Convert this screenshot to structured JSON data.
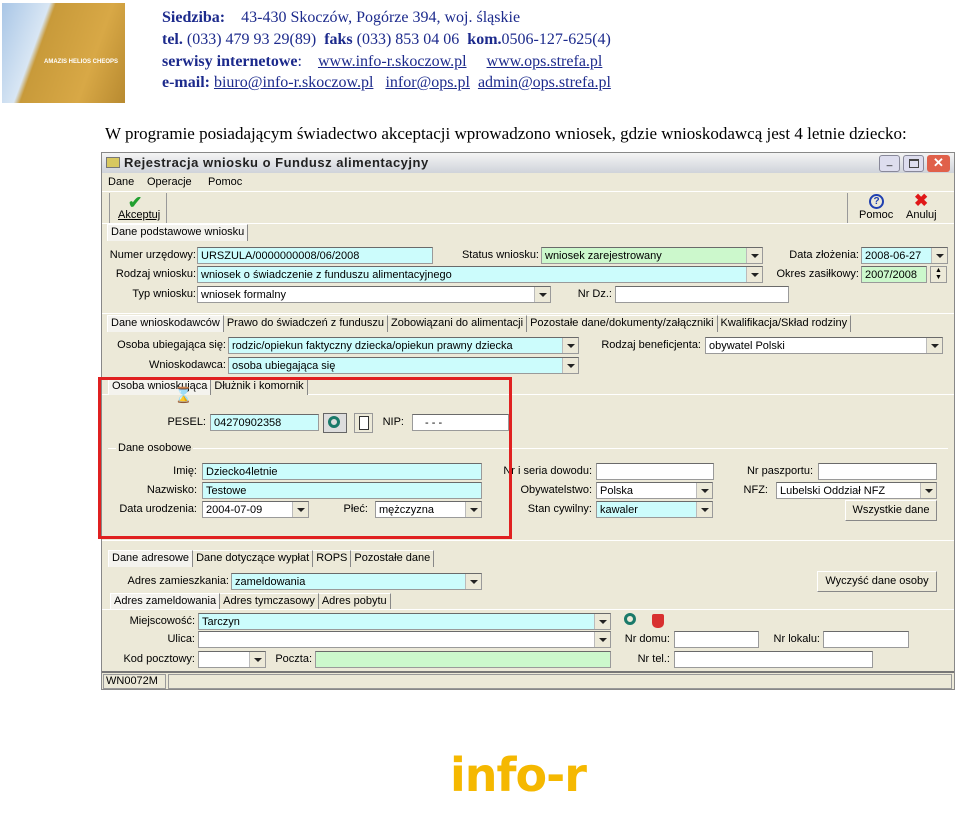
{
  "letterhead": {
    "logo_text": "AMAZIS HELIOS CHEOPS",
    "line1_label": "Siedziba:",
    "line1_text": "43-430 Skoczów,  Pogórze 394,  woj. śląskie",
    "tel_label": "tel.",
    "tel": "(033) 479 93 29(89)",
    "fax_label": "faks",
    "fax": "(033) 853 04 06",
    "kom_label": "kom.",
    "kom": "0506-127-625(4)",
    "web_label": "serwisy internetowe",
    "web_colon": ":",
    "web1": "www.info-r.skoczow.pl",
    "web2": "www.ops.strefa.pl",
    "email_label": "e-mail:",
    "email1": "biuro@info-r.skoczow.pl",
    "email2": "infor@ops.pl",
    "email3": "admin@ops.strefa.pl"
  },
  "heading": "W programie posiadającym świadectwo akceptacji wprowadzono wniosek, gdzie wnioskodawcą jest 4 letnie dziecko:",
  "window": {
    "title": "Rejestracja wniosku o Fundusz alimentacyjny",
    "menu": [
      "Dane",
      "Operacje",
      "Pomoc"
    ],
    "toolbar": {
      "accept": "Akceptuj",
      "help": "Pomoc",
      "cancel": "Anuluj"
    },
    "top_tab": "Dane podstawowe wniosku",
    "basic": {
      "numer_label": "Numer urzędowy:",
      "numer": "URSZULA/0000000008/06/2008",
      "status_label": "Status wniosku:",
      "status": "wniosek zarejestrowany",
      "data_label": "Data złożenia:",
      "data": "2008-06-27",
      "rodzaj_label": "Rodzaj wniosku:",
      "rodzaj": "wniosek o świadczenie z funduszu alimentacyjnego",
      "okres_label": "Okres zasiłkowy:",
      "okres": "2007/2008",
      "typ_label": "Typ wniosku:",
      "typ": "wniosek formalny",
      "nrdz_label": "Nr Dz.:",
      "nrdz": ""
    },
    "main_tabs": [
      "Dane wnioskodawców",
      "Prawo do świadczeń z funduszu",
      "Zobowiązani do alimentacji",
      "Pozostałe dane/dokumenty/załączniki",
      "Kwalifikacja/Skład rodziny"
    ],
    "applicant": {
      "osoba_label": "Osoba ubiegająca się:",
      "osoba": "rodzic/opiekun faktyczny dziecka/opiekun prawny dziecka",
      "benef_label": "Rodzaj beneficjenta:",
      "benef": "obywatel Polski",
      "wniosk_label": "Wnioskodawca:",
      "wniosk": "osoba ubiegająca się"
    },
    "person_tabs": [
      "Osoba wnioskująca",
      "Dłużnik i komornik"
    ],
    "person": {
      "pesel_label": "PESEL:",
      "pesel": "04270902358",
      "nip_label": "NIP:",
      "nip": "- - -",
      "group": "Dane osobowe",
      "imie_label": "Imię:",
      "imie": "Dziecko4letnie",
      "nazwisko_label": "Nazwisko:",
      "nazwisko": "Testowe",
      "dataur_label": "Data urodzenia:",
      "dataur": "2004-07-09",
      "plec_label": "Płeć:",
      "plec": "mężczyzna",
      "dowod_label": "Nr i seria dowodu:",
      "dowod": "",
      "obyw_label": "Obywatelstwo:",
      "obyw": "Polska",
      "stan_label": "Stan cywilny:",
      "stan": "kawaler",
      "paszport_label": "Nr paszportu:",
      "paszport": "",
      "nfz_label": "NFZ:",
      "nfz": "Lubelski Oddział NFZ",
      "all_data": "Wszystkie dane"
    },
    "addr_tabs": [
      "Dane adresowe",
      "Dane dotyczące wypłat",
      "ROPS",
      "Pozostałe dane"
    ],
    "addr": {
      "zam_label": "Adres zamieszkania:",
      "zam": "zameldowania",
      "clear": "Wyczyść dane osoby",
      "sub_tabs": [
        "Adres zameldowania",
        "Adres tymczasowy",
        "Adres pobytu"
      ],
      "miejsc_label": "Miejscowość:",
      "miejsc": "Tarczyn",
      "ulica_label": "Ulica:",
      "ulica": "",
      "nrdomu_label": "Nr domu:",
      "nrdomu": "",
      "nrlok_label": "Nr lokalu:",
      "nrlok": "",
      "kod_label": "Kod pocztowy:",
      "kod": "",
      "poczta_label": "Poczta:",
      "poczta": "",
      "tel_label": "Nr tel.:",
      "tel": ""
    },
    "status_bar": "WN0072M"
  },
  "footer_logo": "info-r",
  "colors": {
    "cyan_field": "#ccfcfc",
    "green_field": "#ccf8cc",
    "highlight": "#e02020",
    "logo": "#f5b800"
  }
}
